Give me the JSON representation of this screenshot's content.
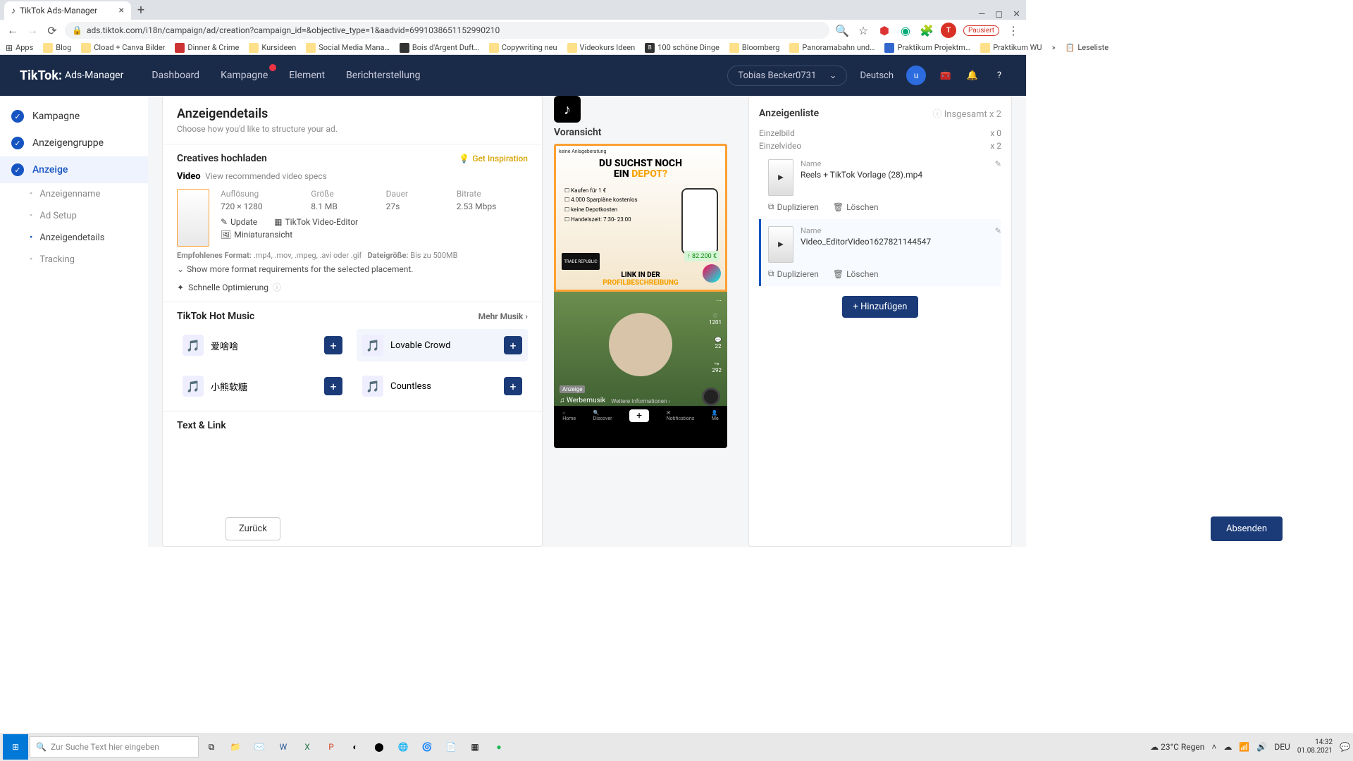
{
  "browser": {
    "tab_title": "TikTok Ads-Manager",
    "url": "ads.tiktok.com/i18n/campaign/ad/creation?campaign_id=&objective_type=1&aadvid=6991038651152990210",
    "pause_label": "Pausiert",
    "reading_list": "Leseliste",
    "bookmarks": [
      "Apps",
      "Blog",
      "Cload + Canva Bilder",
      "Dinner & Crime",
      "Kursideen",
      "Social Media Mana…",
      "Bois d'Argent Duft…",
      "Copywriting neu",
      "Videokurs Ideen",
      "100 schöne Dinge",
      "Bloomberg",
      "Panoramabahn und…",
      "Praktikum Projektm…",
      "Praktikum WU"
    ]
  },
  "nav": {
    "brand_a": "TikTok:",
    "brand_b": "Ads-Manager",
    "items": [
      "Dashboard",
      "Kampagne",
      "Element",
      "Berichterstellung"
    ],
    "account": "Tobias Becker0731",
    "lang": "Deutsch",
    "avatar_letter": "u"
  },
  "sidebar": {
    "steps": [
      "Kampagne",
      "Anzeigengruppe",
      "Anzeige"
    ],
    "substeps": [
      "Anzeigenname",
      "Ad Setup",
      "Anzeigendetails",
      "Tracking"
    ]
  },
  "details": {
    "title": "Anzeigendetails",
    "subtitle": "Choose how you'd like to structure your ad.",
    "creatives_title": "Creatives hochladen",
    "inspiration": "Get Inspiration",
    "video_label": "Video",
    "view_specs": "View recommended video specs",
    "meta_labels": {
      "res": "Auflösung",
      "size": "Größe",
      "dur": "Dauer",
      "bitrate": "Bitrate"
    },
    "meta_values": {
      "res": "720 × 1280",
      "size": "8.1 MB",
      "dur": "27s",
      "bitrate": "2.53 Mbps"
    },
    "actions": {
      "update": "Update",
      "thumb": "Miniaturansicht",
      "editor": "TikTok Video-Editor"
    },
    "format_hint_a": "Empfohlenes Format:",
    "format_hint_b": ".mp4, .mov, .mpeg, .avi oder .gif",
    "size_hint_a": "Dateigröße:",
    "size_hint_b": "Bis zu 500MB",
    "expand": "Show more format requirements for the selected placement.",
    "fast_opt": "Schnelle Optimierung",
    "music_title": "TikTok Hot Music",
    "more_music": "Mehr Musik",
    "tracks": [
      "爱啥啥",
      "Lovable Crowd",
      "小熊软糖",
      "Countless"
    ],
    "text_link": "Text & Link"
  },
  "preview": {
    "title": "Voransicht",
    "ad_headline_a": "DU SUCHST NOCH",
    "ad_headline_b": "EIN",
    "ad_headline_c": "DEPOT?",
    "checks": [
      "Kaufen für 1 €",
      "4.000 Sparpläne kostenlos",
      "keine Depotkosten",
      "Handelszeit: 7:30- 23:00"
    ],
    "trade_label": "TRADE REPUBLIC",
    "price": "↑ 82.200 €",
    "link_a": "LINK IN DER",
    "link_b": "PROFILBESCHREIBUNG",
    "disclaimer": "keine Anlageberatung",
    "badge": "Anzeige",
    "music": "♫ Werbemusik",
    "more_info": "Weitere Informationen ›",
    "count1": "1201",
    "count2": "22",
    "count3": "292",
    "nav": [
      "Home",
      "Discover",
      "",
      "Notifications",
      "Me"
    ]
  },
  "adlist": {
    "title": "Anzeigenliste",
    "total": "Insgesamt x 2",
    "rows": [
      {
        "label": "Einzelbild",
        "count": "x 0"
      },
      {
        "label": "Einzelvideo",
        "count": "x 2"
      }
    ],
    "name_label": "Name",
    "items": [
      {
        "file": "Reels + TikTok Vorlage (28).mp4"
      },
      {
        "file": "Video_EditorVideo1627821144547"
      }
    ],
    "dup": "Duplizieren",
    "del": "Löschen",
    "add": "+ Hinzufügen"
  },
  "footer": {
    "back": "Zurück",
    "submit": "Absenden"
  },
  "taskbar": {
    "search_placeholder": "Zur Suche Text hier eingeben",
    "weather": "23°C Regen",
    "lang": "DEU",
    "time": "14:32",
    "date": "01.08.2021"
  }
}
